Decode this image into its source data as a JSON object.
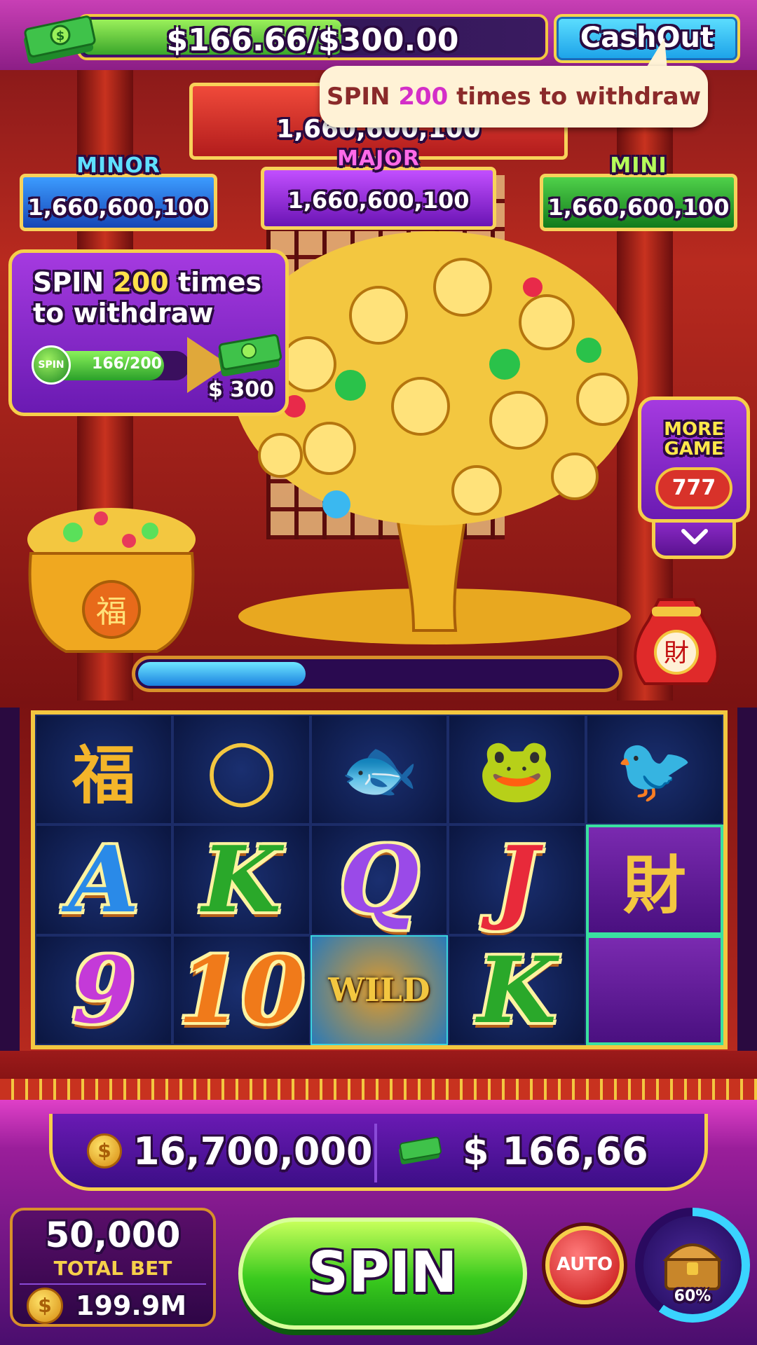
{
  "header": {
    "balance_text": "$166.66/$300.00",
    "balance_progress": 0.5555,
    "cashout_label": "CashOut",
    "tooltip": {
      "prefix": "SPIN ",
      "count": "200",
      "suffix": " times to withdraw"
    },
    "info_icon": "info-icon",
    "menu_icon": "hamburger-menu-icon"
  },
  "jackpots": {
    "grand": {
      "value": "1,660,600,100"
    },
    "minor": {
      "label": "MINOR",
      "value": "1,660,600,100"
    },
    "major": {
      "label": "MAJOR",
      "value": "1,660,600,100"
    },
    "mini": {
      "label": "MINI",
      "value": "1,660,600,100"
    }
  },
  "task": {
    "title_prefix": "SPIN ",
    "title_count": "200",
    "title_suffix": " times to withdraw",
    "spin_icon_label": "SPIN",
    "progress_text": "166/200",
    "progress": 0.83,
    "reward": "$ 300"
  },
  "more_game": {
    "label": "MORE GAME",
    "sub": "777"
  },
  "reel_progress": 0.35,
  "reels": [
    [
      {
        "name": "gold-ingot-symbol",
        "glyph": "福",
        "color": "#f3b52a"
      },
      {
        "name": "jade-bangle-symbol",
        "glyph": "◯",
        "color": "#f3c740"
      },
      {
        "name": "koi-fish-symbol",
        "glyph": "🐟",
        "color": "#f3b52a"
      },
      {
        "name": "golden-toad-symbol",
        "glyph": "🐸",
        "color": "#e8c23a"
      },
      {
        "name": "phoenix-symbol",
        "glyph": "🐦",
        "color": "#f0622a"
      }
    ],
    [
      {
        "name": "letter-a-symbol",
        "glyph": "A",
        "color": "#2a8ae8"
      },
      {
        "name": "letter-k-symbol",
        "glyph": "K",
        "color": "#2aa82a"
      },
      {
        "name": "letter-q-symbol",
        "glyph": "Q",
        "color": "#9a4ae8"
      },
      {
        "name": "letter-j-symbol",
        "glyph": "J",
        "color": "#e82a3a"
      },
      {
        "name": "money-tree-symbol",
        "glyph": "財",
        "color": "#f3c740"
      }
    ],
    [
      {
        "name": "number-9-symbol",
        "glyph": "9",
        "color": "#c43ad8"
      },
      {
        "name": "number-10-symbol",
        "glyph": "10",
        "color": "#f07a1a"
      },
      {
        "name": "wild-symbol",
        "glyph": "WILD",
        "color": "#f3c740"
      },
      {
        "name": "letter-k-symbol",
        "glyph": "K",
        "color": "#2aa82a"
      },
      {
        "name": "money-tree-symbol-cont",
        "glyph": "",
        "color": "#f3c740"
      }
    ]
  ],
  "wallet": {
    "coins": "16,700,000",
    "cash": "$ 166,66"
  },
  "bet": {
    "value": "50,000",
    "label": "TOTAL BET",
    "balance": "199.9M"
  },
  "controls": {
    "spin_label": "SPIN",
    "auto_label": "AUTO",
    "chest_percent": "60%",
    "chest_progress": 0.6
  },
  "colors": {
    "accent_magenta": "#c83fb5",
    "gold": "#f3c740",
    "spin_green": "#3aca1e",
    "cashout_blue": "#1aa0e8"
  }
}
